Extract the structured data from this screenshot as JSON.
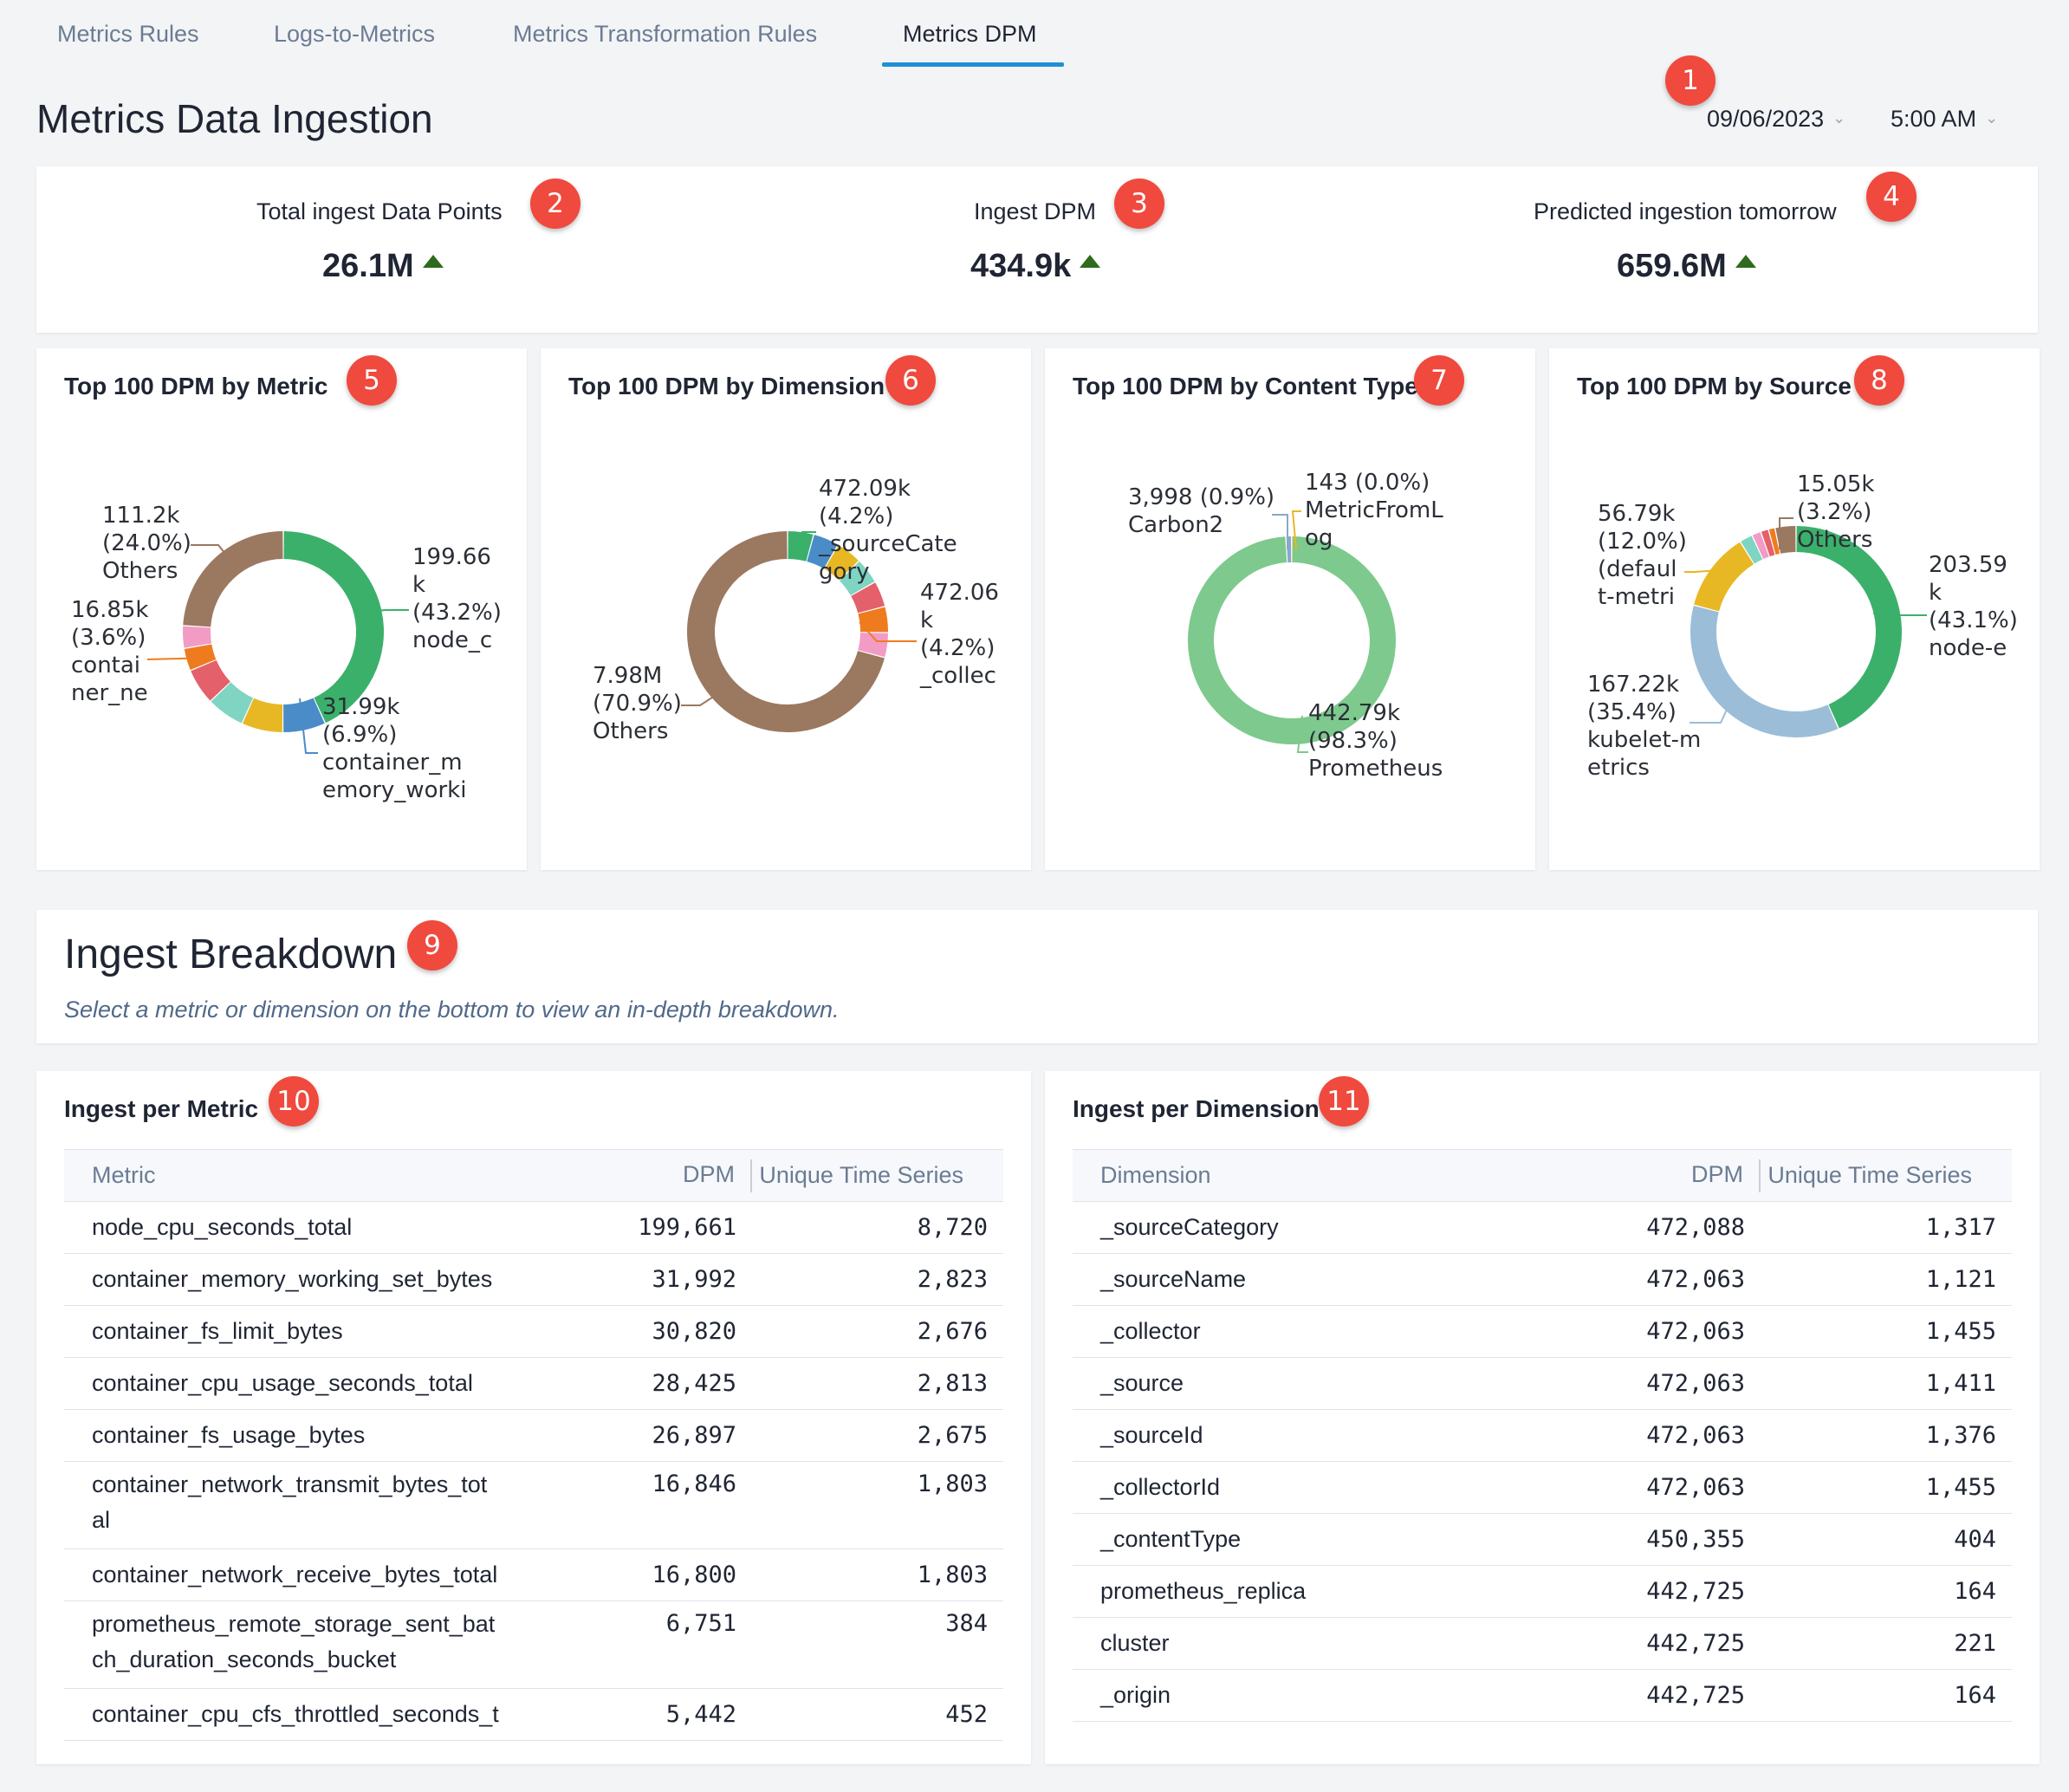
{
  "tabs": [
    {
      "label": "Metrics Rules"
    },
    {
      "label": "Logs-to-Metrics"
    },
    {
      "label": "Metrics Transformation Rules"
    },
    {
      "label": "Metrics DPM"
    }
  ],
  "page_title": "Metrics Data Ingestion",
  "date_picker": {
    "value": "09/06/2023"
  },
  "time_picker": {
    "value": "5:00 AM"
  },
  "badges": [
    "1",
    "2",
    "3",
    "4",
    "5",
    "6",
    "7",
    "8",
    "9",
    "10",
    "11"
  ],
  "kpis": [
    {
      "label": "Total ingest Data Points",
      "value": "26.1M"
    },
    {
      "label": "Ingest DPM",
      "value": "434.9k"
    },
    {
      "label": "Predicted ingestion tomorrow",
      "value": "659.6M"
    }
  ],
  "charts": [
    {
      "title": "Top 100 DPM by Metric"
    },
    {
      "title": "Top 100 DPM by Dimension"
    },
    {
      "title": "Top 100 DPM by Content Type"
    },
    {
      "title": "Top 100 DPM by Source"
    }
  ],
  "chart_data": [
    {
      "type": "pie",
      "title": "Top 100 DPM by Metric",
      "slices": [
        {
          "label": "node_c",
          "value": 199660,
          "percent": 43.2,
          "display": "199.66 k",
          "color": "#3bb06b"
        },
        {
          "label": "container_memory_worki",
          "value": 31990,
          "percent": 6.9,
          "display": "31.99k",
          "color": "#4a8cc8"
        },
        {
          "label": "",
          "value": 30820,
          "percent": 6.7,
          "color": "#e8b724"
        },
        {
          "label": "",
          "value": 28425,
          "percent": 6.2,
          "color": "#7fd4c2"
        },
        {
          "label": "",
          "value": 26897,
          "percent": 5.8,
          "color": "#e4606a"
        },
        {
          "label": "container_ne",
          "value": 16850,
          "percent": 3.6,
          "display": "16.85k",
          "color": "#ee7c1f"
        },
        {
          "label": "",
          "value": 16800,
          "percent": 3.6,
          "color": "#f29bc4"
        },
        {
          "label": "Others",
          "value": 111200,
          "percent": 24.0,
          "display": "111.2k",
          "color": "#9b7860"
        }
      ]
    },
    {
      "type": "pie",
      "title": "Top 100 DPM by Dimension",
      "slices": [
        {
          "label": "_sourceCategory",
          "value": 472090,
          "percent": 4.2,
          "display": "472.09k",
          "color": "#3bb06b"
        },
        {
          "label": "",
          "value": 472063,
          "percent": 4.2,
          "color": "#4a8cc8"
        },
        {
          "label": "",
          "value": 472063,
          "percent": 4.2,
          "color": "#e8b724"
        },
        {
          "label": "",
          "value": 472063,
          "percent": 4.2,
          "color": "#7fd4c2"
        },
        {
          "label": "",
          "value": 472063,
          "percent": 4.2,
          "color": "#e4606a"
        },
        {
          "label": "_collec",
          "value": 472060,
          "percent": 4.2,
          "display": "472.06 k",
          "color": "#ee7c1f"
        },
        {
          "label": "",
          "value": 450355,
          "percent": 4.0,
          "color": "#f29bc4"
        },
        {
          "label": "Others",
          "value": 7980000,
          "percent": 70.9,
          "display": "7.98M",
          "color": "#9b7860"
        }
      ]
    },
    {
      "type": "pie",
      "title": "Top 100 DPM by Content Type",
      "slices": [
        {
          "label": "Prometheus",
          "value": 442790,
          "percent": 98.3,
          "display": "442.79k",
          "color": "#7ec98d"
        },
        {
          "label": "Carbon2",
          "value": 3998,
          "percent": 0.9,
          "display": "3,998",
          "color": "#8aa8c8"
        },
        {
          "label": "MetricFromLog",
          "value": 143,
          "percent": 0.0,
          "display": "143",
          "color": "#e8b724"
        }
      ]
    },
    {
      "type": "pie",
      "title": "Top 100 DPM by Source",
      "slices": [
        {
          "label": "node-e",
          "value": 203590,
          "percent": 43.1,
          "display": "203.59 k",
          "color": "#3bb06b"
        },
        {
          "label": "kubelet-metrics",
          "value": 167220,
          "percent": 35.4,
          "display": "167.22k",
          "color": "#9bbdd8"
        },
        {
          "label": "(default-metri",
          "value": 56790,
          "percent": 12.0,
          "display": "56.79k",
          "color": "#e8b724"
        },
        {
          "label": "",
          "value": 9450,
          "percent": 2.0,
          "color": "#7fd4c2"
        },
        {
          "label": "",
          "value": 6600,
          "percent": 1.4,
          "color": "#f29bc4"
        },
        {
          "label": "",
          "value": 5700,
          "percent": 1.2,
          "color": "#e4606a"
        },
        {
          "label": "",
          "value": 4700,
          "percent": 1.0,
          "color": "#ee7c1f"
        },
        {
          "label": "Others",
          "value": 15050,
          "percent": 3.2,
          "display": "15.05k",
          "color": "#9b7860"
        }
      ]
    }
  ],
  "donut_labels": [
    [
      {
        "lines": [
          "199.66",
          "k",
          "(43.2%)",
          "node_c"
        ]
      },
      {
        "lines": [
          "31.99k",
          "(6.9%)",
          "container_m",
          "emory_worki"
        ]
      },
      {
        "lines": [
          "16.85k",
          "(3.6%)",
          "contai",
          "ner_ne"
        ]
      },
      {
        "lines": [
          "111.2k",
          "(24.0%)",
          "Others"
        ]
      }
    ],
    [
      {
        "lines": [
          "472.09k",
          "(4.2%)",
          "_sourceCate",
          "gory"
        ]
      },
      {
        "lines": [
          "472.06",
          "k",
          "(4.2%)",
          "_collec"
        ]
      },
      {
        "lines": [
          "7.98M",
          "(70.9%)",
          "Others"
        ]
      }
    ],
    [
      {
        "lines": [
          "3,998 (0.9%)",
          "Carbon2"
        ]
      },
      {
        "lines": [
          "143 (0.0%)",
          "MetricFromL",
          "og"
        ]
      },
      {
        "lines": [
          "442.79k",
          "(98.3%)",
          "Prometheus"
        ]
      }
    ],
    [
      {
        "lines": [
          "15.05k",
          "(3.2%)",
          "Others"
        ]
      },
      {
        "lines": [
          "56.79k",
          "(12.0%)",
          "(defaul",
          "t-metri"
        ]
      },
      {
        "lines": [
          "203.59",
          "k",
          "(43.1%)",
          "node-e"
        ]
      },
      {
        "lines": [
          "167.22k",
          "(35.4%)",
          "kubelet-m",
          "etrics"
        ]
      }
    ]
  ],
  "breakdown": {
    "title": "Ingest Breakdown",
    "subtitle": "Select a metric or dimension on the bottom to view an in-depth breakdown."
  },
  "metric_table": {
    "title": "Ingest per Metric",
    "headers": [
      "Metric",
      "DPM",
      "Unique Time Series"
    ],
    "rows": [
      {
        "name": "node_cpu_seconds_total",
        "dpm": "199,661",
        "uts": "8,720"
      },
      {
        "name": "container_memory_working_set_bytes",
        "dpm": "31,992",
        "uts": "2,823"
      },
      {
        "name": "container_fs_limit_bytes",
        "dpm": "30,820",
        "uts": "2,676"
      },
      {
        "name": "container_cpu_usage_seconds_total",
        "dpm": "28,425",
        "uts": "2,813"
      },
      {
        "name": "container_fs_usage_bytes",
        "dpm": "26,897",
        "uts": "2,675"
      },
      {
        "name1": "container_network_transmit_bytes_tot",
        "name2": "al",
        "dpm": "16,846",
        "uts": "1,803"
      },
      {
        "name": "container_network_receive_bytes_total",
        "dpm": "16,800",
        "uts": "1,803"
      },
      {
        "name1": "prometheus_remote_storage_sent_bat",
        "name2": "ch_duration_seconds_bucket",
        "dpm": "6,751",
        "uts": "384"
      },
      {
        "name": "container_cpu_cfs_throttled_seconds_t",
        "dpm": "5,442",
        "uts": "452"
      }
    ]
  },
  "dimension_table": {
    "title": "Ingest per Dimension",
    "headers": [
      "Dimension",
      "DPM",
      "Unique Time Series"
    ],
    "rows": [
      {
        "name": "_sourceCategory",
        "dpm": "472,088",
        "uts": "1,317"
      },
      {
        "name": "_sourceName",
        "dpm": "472,063",
        "uts": "1,121"
      },
      {
        "name": "_collector",
        "dpm": "472,063",
        "uts": "1,455"
      },
      {
        "name": "_source",
        "dpm": "472,063",
        "uts": "1,411"
      },
      {
        "name": "_sourceId",
        "dpm": "472,063",
        "uts": "1,376"
      },
      {
        "name": "_collectorId",
        "dpm": "472,063",
        "uts": "1,455"
      },
      {
        "name": "_contentType",
        "dpm": "450,355",
        "uts": "404"
      },
      {
        "name": "prometheus_replica",
        "dpm": "442,725",
        "uts": "164"
      },
      {
        "name": "cluster",
        "dpm": "442,725",
        "uts": "221"
      },
      {
        "name": "_origin",
        "dpm": "442,725",
        "uts": "164"
      }
    ]
  }
}
